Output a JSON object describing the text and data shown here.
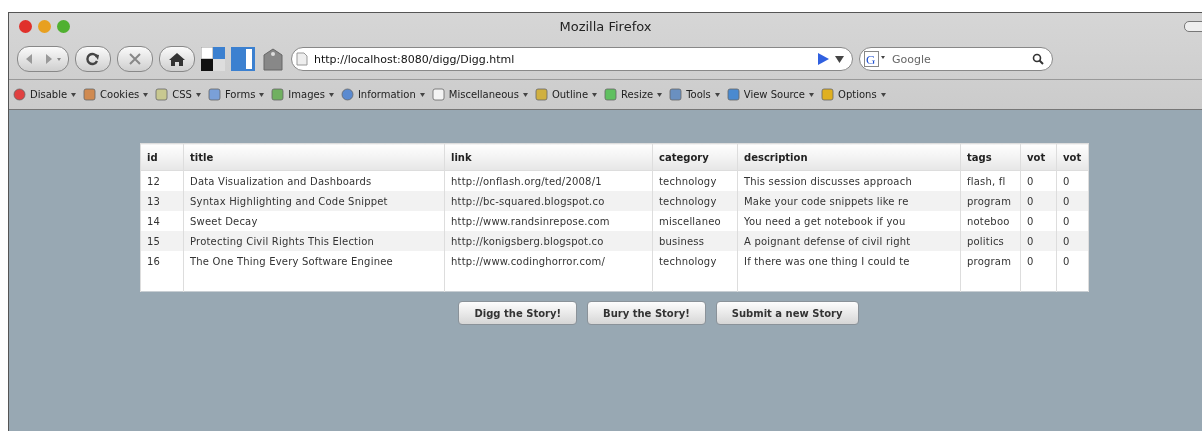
{
  "window": {
    "title": "Mozilla Firefox"
  },
  "toolbar": {
    "url": "http://localhost:8080/digg/Digg.html",
    "search": {
      "engine_letter": "G",
      "placeholder": "Google"
    }
  },
  "dev_toolbar": [
    "Disable",
    "Cookies",
    "CSS",
    "Forms",
    "Images",
    "Information",
    "Miscellaneous",
    "Outline",
    "Resize",
    "Tools",
    "View Source",
    "Options"
  ],
  "table": {
    "columns": [
      "id",
      "title",
      "link",
      "category",
      "description",
      "tags",
      "vot",
      "vot"
    ],
    "rows": [
      [
        "12",
        "Data Visualization and Dashboards",
        "http://onflash.org/ted/2008/1",
        "technology",
        "This session discusses approach",
        "flash, fl",
        "0",
        "0"
      ],
      [
        "13",
        "Syntax Highlighting and Code Snippet",
        "http://bc-squared.blogspot.co",
        "technology",
        "Make your code snippets like re",
        "program",
        "0",
        "0"
      ],
      [
        "14",
        "Sweet Decay",
        "http://www.randsinrepose.com",
        "miscellaneo",
        "You need a get notebook if you",
        "noteboo",
        "0",
        "0"
      ],
      [
        "15",
        "Protecting Civil Rights This Election",
        "http://konigsberg.blogspot.co",
        "business",
        "A poignant defense of civil right",
        "politics",
        "0",
        "0"
      ],
      [
        "16",
        "The One Thing Every Software Enginee",
        "http://www.codinghorror.com/",
        "technology",
        "If there was one thing I could te",
        "program",
        "0",
        "0"
      ]
    ]
  },
  "buttons": [
    "Digg the Story!",
    "Bury the Story!",
    "Submit a new Story"
  ]
}
